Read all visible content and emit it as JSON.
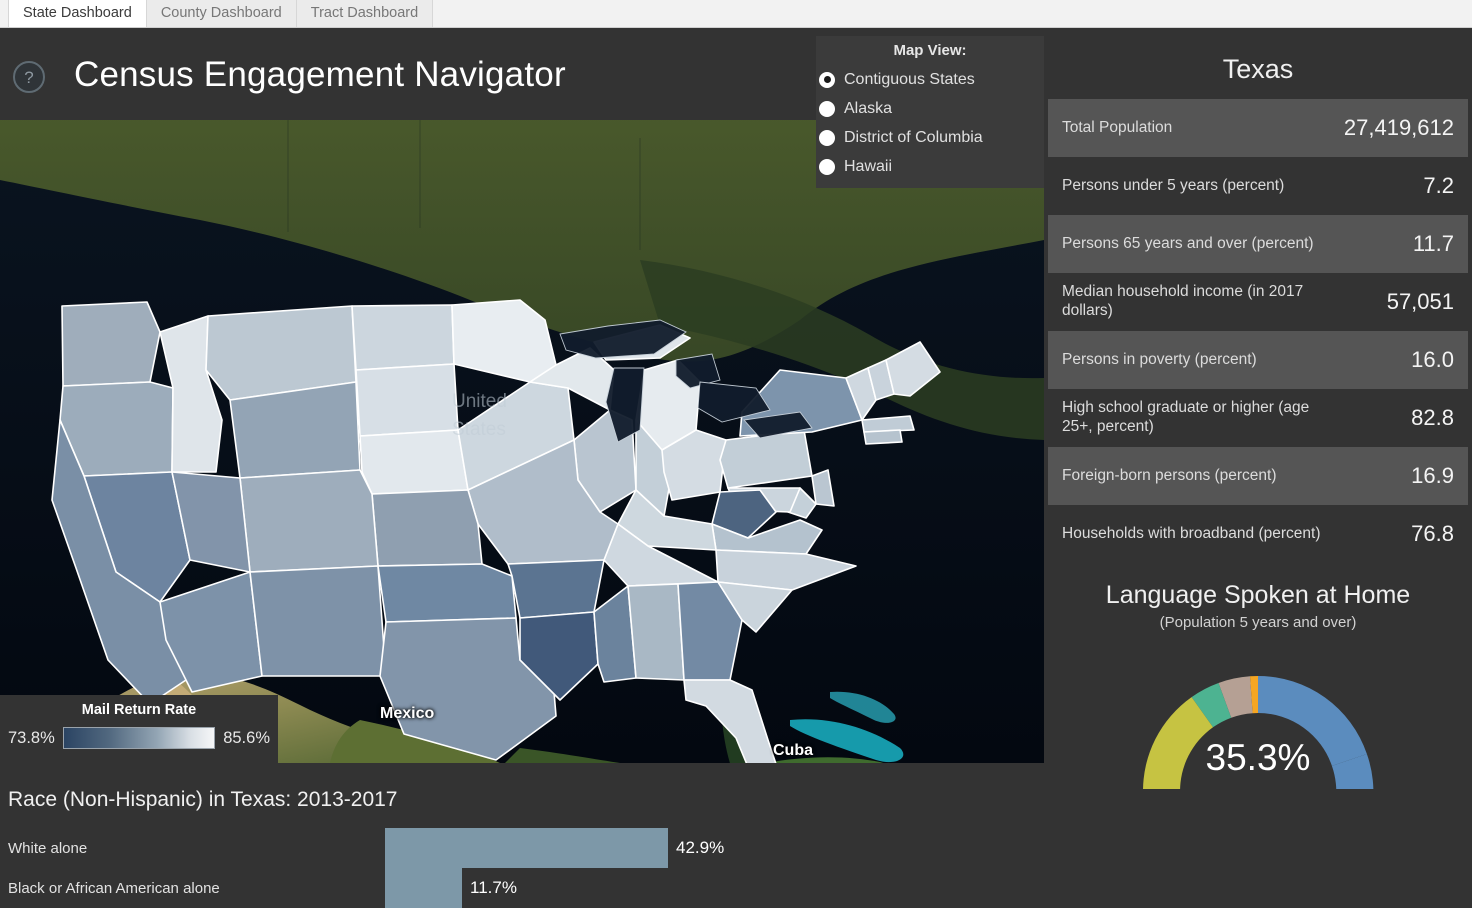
{
  "tabs": [
    {
      "label": "State Dashboard",
      "active": true
    },
    {
      "label": "County Dashboard",
      "active": false
    },
    {
      "label": "Tract Dashboard",
      "active": false
    }
  ],
  "header": {
    "title": "Census Engagement Navigator",
    "help_icon_glyph": "?"
  },
  "map_view": {
    "title": "Map View:",
    "options": [
      {
        "label": "Contiguous States",
        "selected": true
      },
      {
        "label": "Alaska",
        "selected": false
      },
      {
        "label": "District of Columbia",
        "selected": false
      },
      {
        "label": "Hawaii",
        "selected": false
      }
    ]
  },
  "map": {
    "labels": [
      {
        "text": "United States",
        "faint": true
      },
      {
        "text": "Mexico",
        "faint": false
      },
      {
        "text": "Cuba",
        "faint": false
      }
    ],
    "label_united_states_line1": "United",
    "label_united_states_line2": "States",
    "label_mexico": "Mexico",
    "label_cuba": "Cuba"
  },
  "legend": {
    "title": "Mail Return Rate",
    "min": "73.8%",
    "max": "85.6%",
    "gradient_low_color": "#2b4463",
    "gradient_high_color": "#f6f7f8"
  },
  "panel": {
    "state": "Texas",
    "stats": [
      {
        "label": "Total Population",
        "value": "27,419,612"
      },
      {
        "label": "Persons under 5 years (percent)",
        "value": "7.2"
      },
      {
        "label": "Persons 65 years and over (percent)",
        "value": "11.7"
      },
      {
        "label": "Median household income (in 2017 dollars)",
        "value": "57,051"
      },
      {
        "label": "Persons in poverty (percent)",
        "value": "16.0"
      },
      {
        "label": "High school graduate or higher (age 25+, percent)",
        "value": "82.8"
      },
      {
        "label": "Foreign-born persons (percent)",
        "value": "16.9"
      },
      {
        "label": "Households with broadband (percent)",
        "value": "76.8"
      }
    ]
  },
  "language": {
    "title": "Language Spoken at Home",
    "subtitle": "(Population 5 years and over)",
    "center_value": "35.3%"
  },
  "race_chart": {
    "title": "Race (Non-Hispanic) in Texas: 2013-2017",
    "rows": [
      {
        "label": "White alone",
        "value": "42.9%"
      },
      {
        "label": "Black or African American alone",
        "value": "11.7%"
      }
    ]
  },
  "chart_data": [
    {
      "type": "bar",
      "title": "Race (Non-Hispanic) in Texas: 2013-2017",
      "orientation": "horizontal",
      "categories": [
        "White alone",
        "Black or African American alone"
      ],
      "values": [
        42.9,
        11.7
      ],
      "value_labels": [
        "42.9%",
        "11.7%"
      ],
      "xlabel": "",
      "ylabel": "",
      "xlim": [
        0,
        63
      ],
      "grid": false,
      "bar_color": "#7d98a8",
      "note": "Chart is clipped at the bottom edge of the screenshot; only two categories visible."
    },
    {
      "type": "pie",
      "title": "Language Spoken at Home",
      "subtitle": "(Population 5 years and over)",
      "center_label": "35.3%",
      "donut": true,
      "note": "Donut is clipped by the bottom of the screenshot; slice percentages are not labeled.",
      "slices": [
        {
          "name": "slice-1",
          "color": "#5b8cbe",
          "approx_fraction": 0.353
        },
        {
          "name": "slice-2",
          "color": "#c6c342",
          "approx_fraction": 0.21
        },
        {
          "name": "slice-3",
          "color": "#4db391",
          "approx_fraction": 0.04
        },
        {
          "name": "slice-4",
          "color": "#b5a094",
          "approx_fraction": 0.03
        },
        {
          "name": "slice-5",
          "color": "#f5a623",
          "approx_fraction": 0.008
        }
      ]
    },
    {
      "type": "heatmap",
      "title": "Mail Return Rate choropleth of the contiguous United States",
      "legend_min": 73.8,
      "legend_max": 85.6,
      "unit": "percent",
      "low_color": "#2b4463",
      "high_color": "#f6f7f8"
    }
  ]
}
